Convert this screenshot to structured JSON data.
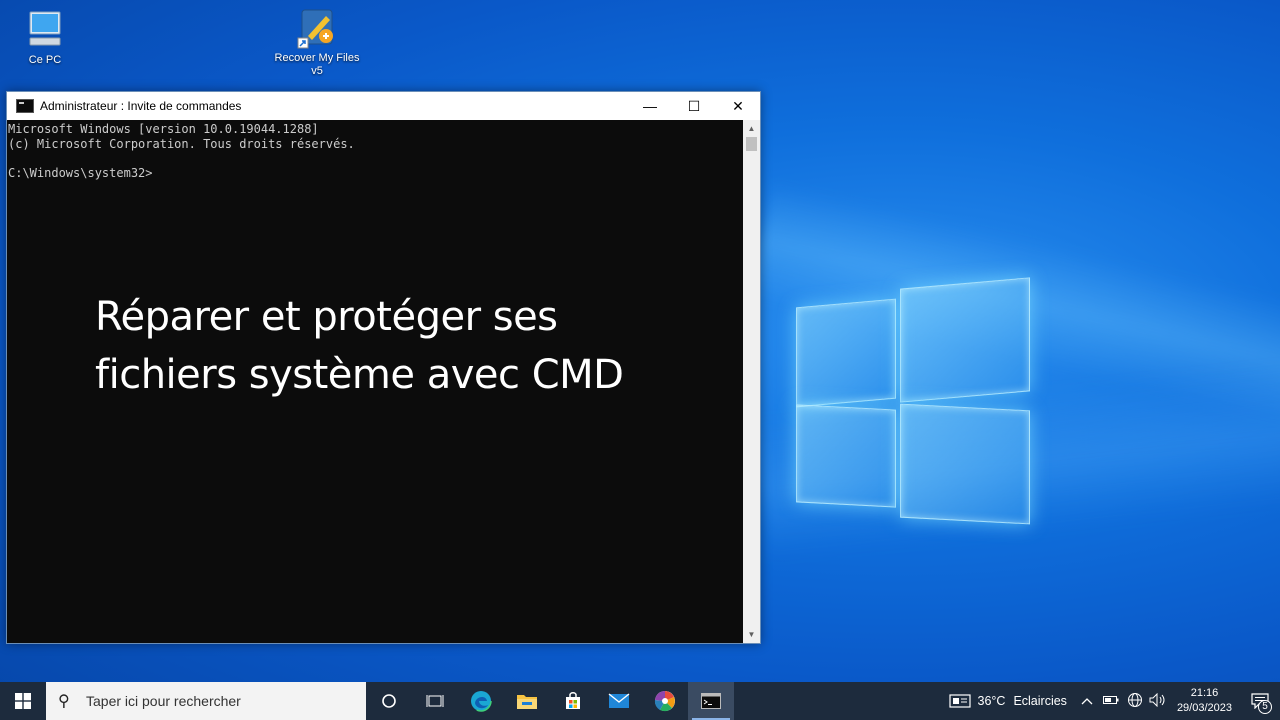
{
  "desktop": {
    "icons": [
      {
        "label": "Ce PC"
      },
      {
        "label": "Recover My Files v5"
      }
    ]
  },
  "window": {
    "title": "Administrateur : Invite de commandes",
    "controls": {
      "minimize": "—",
      "maximize": "☐",
      "close": "✕"
    },
    "console_lines": [
      "Microsoft Windows [version 10.0.19044.1288]",
      "(c) Microsoft Corporation. Tous droits réservés.",
      "",
      "C:\\Windows\\system32>"
    ],
    "overlay": {
      "line1": "Réparer et protéger ses",
      "line2": "fichiers système avec CMD"
    }
  },
  "taskbar": {
    "search_placeholder": "Taper ici pour rechercher",
    "apps": [
      "cortana-icon",
      "task-view-icon",
      "edge-icon",
      "file-explorer-icon",
      "store-icon",
      "mail-icon",
      "photos-icon",
      "cmd-icon"
    ],
    "weather": {
      "temp": "36°C",
      "condition": "Eclaircies"
    },
    "clock": {
      "time": "21:16",
      "date": "29/03/2023"
    },
    "notifications": "5"
  }
}
